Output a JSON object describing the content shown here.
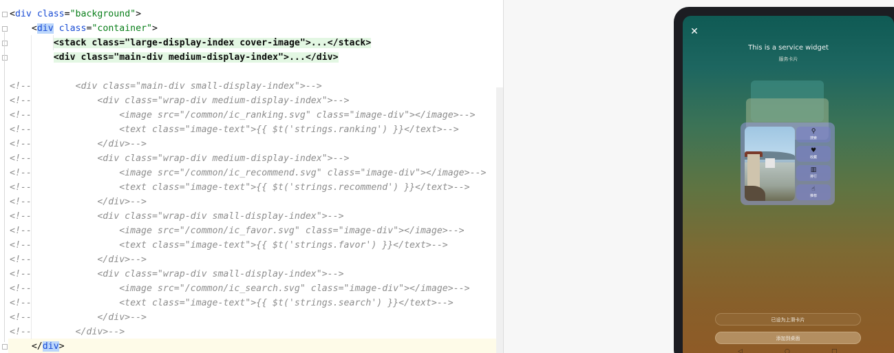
{
  "editor": {
    "lines": [
      {
        "type": "code",
        "indent": "",
        "parts": [
          [
            "punct",
            "<"
          ],
          [
            "tag",
            "div"
          ],
          [
            "attr",
            " class"
          ],
          [
            "punct",
            "="
          ],
          [
            "str",
            "\"background\""
          ],
          [
            "punct",
            ">"
          ]
        ]
      },
      {
        "type": "code",
        "indent": "    ",
        "parts": [
          [
            "punct",
            "<"
          ],
          [
            "seltag",
            "div"
          ],
          [
            "attr",
            " class"
          ],
          [
            "punct",
            "="
          ],
          [
            "str",
            "\"container\""
          ],
          [
            "punct",
            ">"
          ]
        ]
      },
      {
        "type": "collapsed",
        "indent": "        ",
        "text": "<stack class=\"large-display-index cover-image\">...</stack>"
      },
      {
        "type": "collapsed",
        "indent": "        ",
        "text": "<div class=\"main-div medium-display-index\">...</div>"
      },
      {
        "type": "blank"
      },
      {
        "type": "comment",
        "text": "<!--        <div class=\"main-div small-display-index\">-->"
      },
      {
        "type": "comment",
        "text": "<!--            <div class=\"wrap-div medium-display-index\">-->"
      },
      {
        "type": "comment",
        "text": "<!--                <image src=\"/common/ic_ranking.svg\" class=\"image-div\"></image>-->"
      },
      {
        "type": "comment",
        "text": "<!--                <text class=\"image-text\">{{ $t('strings.ranking') }}</text>-->"
      },
      {
        "type": "comment",
        "text": "<!--            </div>-->"
      },
      {
        "type": "comment",
        "text": "<!--            <div class=\"wrap-div medium-display-index\">-->"
      },
      {
        "type": "comment",
        "text": "<!--                <image src=\"/common/ic_recommend.svg\" class=\"image-div\"></image>-->"
      },
      {
        "type": "comment",
        "text": "<!--                <text class=\"image-text\">{{ $t('strings.recommend') }}</text>-->"
      },
      {
        "type": "comment",
        "text": "<!--            </div>-->"
      },
      {
        "type": "comment",
        "text": "<!--            <div class=\"wrap-div small-display-index\">-->"
      },
      {
        "type": "comment",
        "text": "<!--                <image src=\"/common/ic_favor.svg\" class=\"image-div\"></image>-->"
      },
      {
        "type": "comment",
        "text": "<!--                <text class=\"image-text\">{{ $t('strings.favor') }}</text>-->"
      },
      {
        "type": "comment",
        "text": "<!--            </div>-->"
      },
      {
        "type": "comment",
        "text": "<!--            <div class=\"wrap-div small-display-index\">-->"
      },
      {
        "type": "comment",
        "text": "<!--                <image src=\"/common/ic_search.svg\" class=\"image-div\"></image>-->"
      },
      {
        "type": "comment",
        "text": "<!--                <text class=\"image-text\">{{ $t('strings.search') }}</text>-->"
      },
      {
        "type": "comment",
        "text": "<!--            </div>-->"
      },
      {
        "type": "comment",
        "text": "<!--        </div>-->"
      },
      {
        "type": "code",
        "indent": "    ",
        "parts": [
          [
            "punct",
            "</"
          ],
          [
            "seltag",
            "div"
          ],
          [
            "punct",
            ">"
          ]
        ]
      }
    ]
  },
  "preview": {
    "title": "This is a service widget",
    "subtitle": "服务卡片",
    "close_icon": "close-icon",
    "side_buttons": [
      {
        "icon": "search-icon",
        "glyph": "⚲",
        "label": "搜索"
      },
      {
        "icon": "heart-icon",
        "glyph": "♥",
        "label": "收藏"
      },
      {
        "icon": "ranking-icon",
        "glyph": "▥",
        "label": "排行"
      },
      {
        "icon": "thumbs-up-icon",
        "glyph": "☝",
        "label": "推荐"
      }
    ],
    "set_button": "已设为上滑卡片",
    "add_button": "添加到桌面",
    "nav": {
      "back": "◁",
      "home": "○",
      "recent": "□"
    }
  }
}
